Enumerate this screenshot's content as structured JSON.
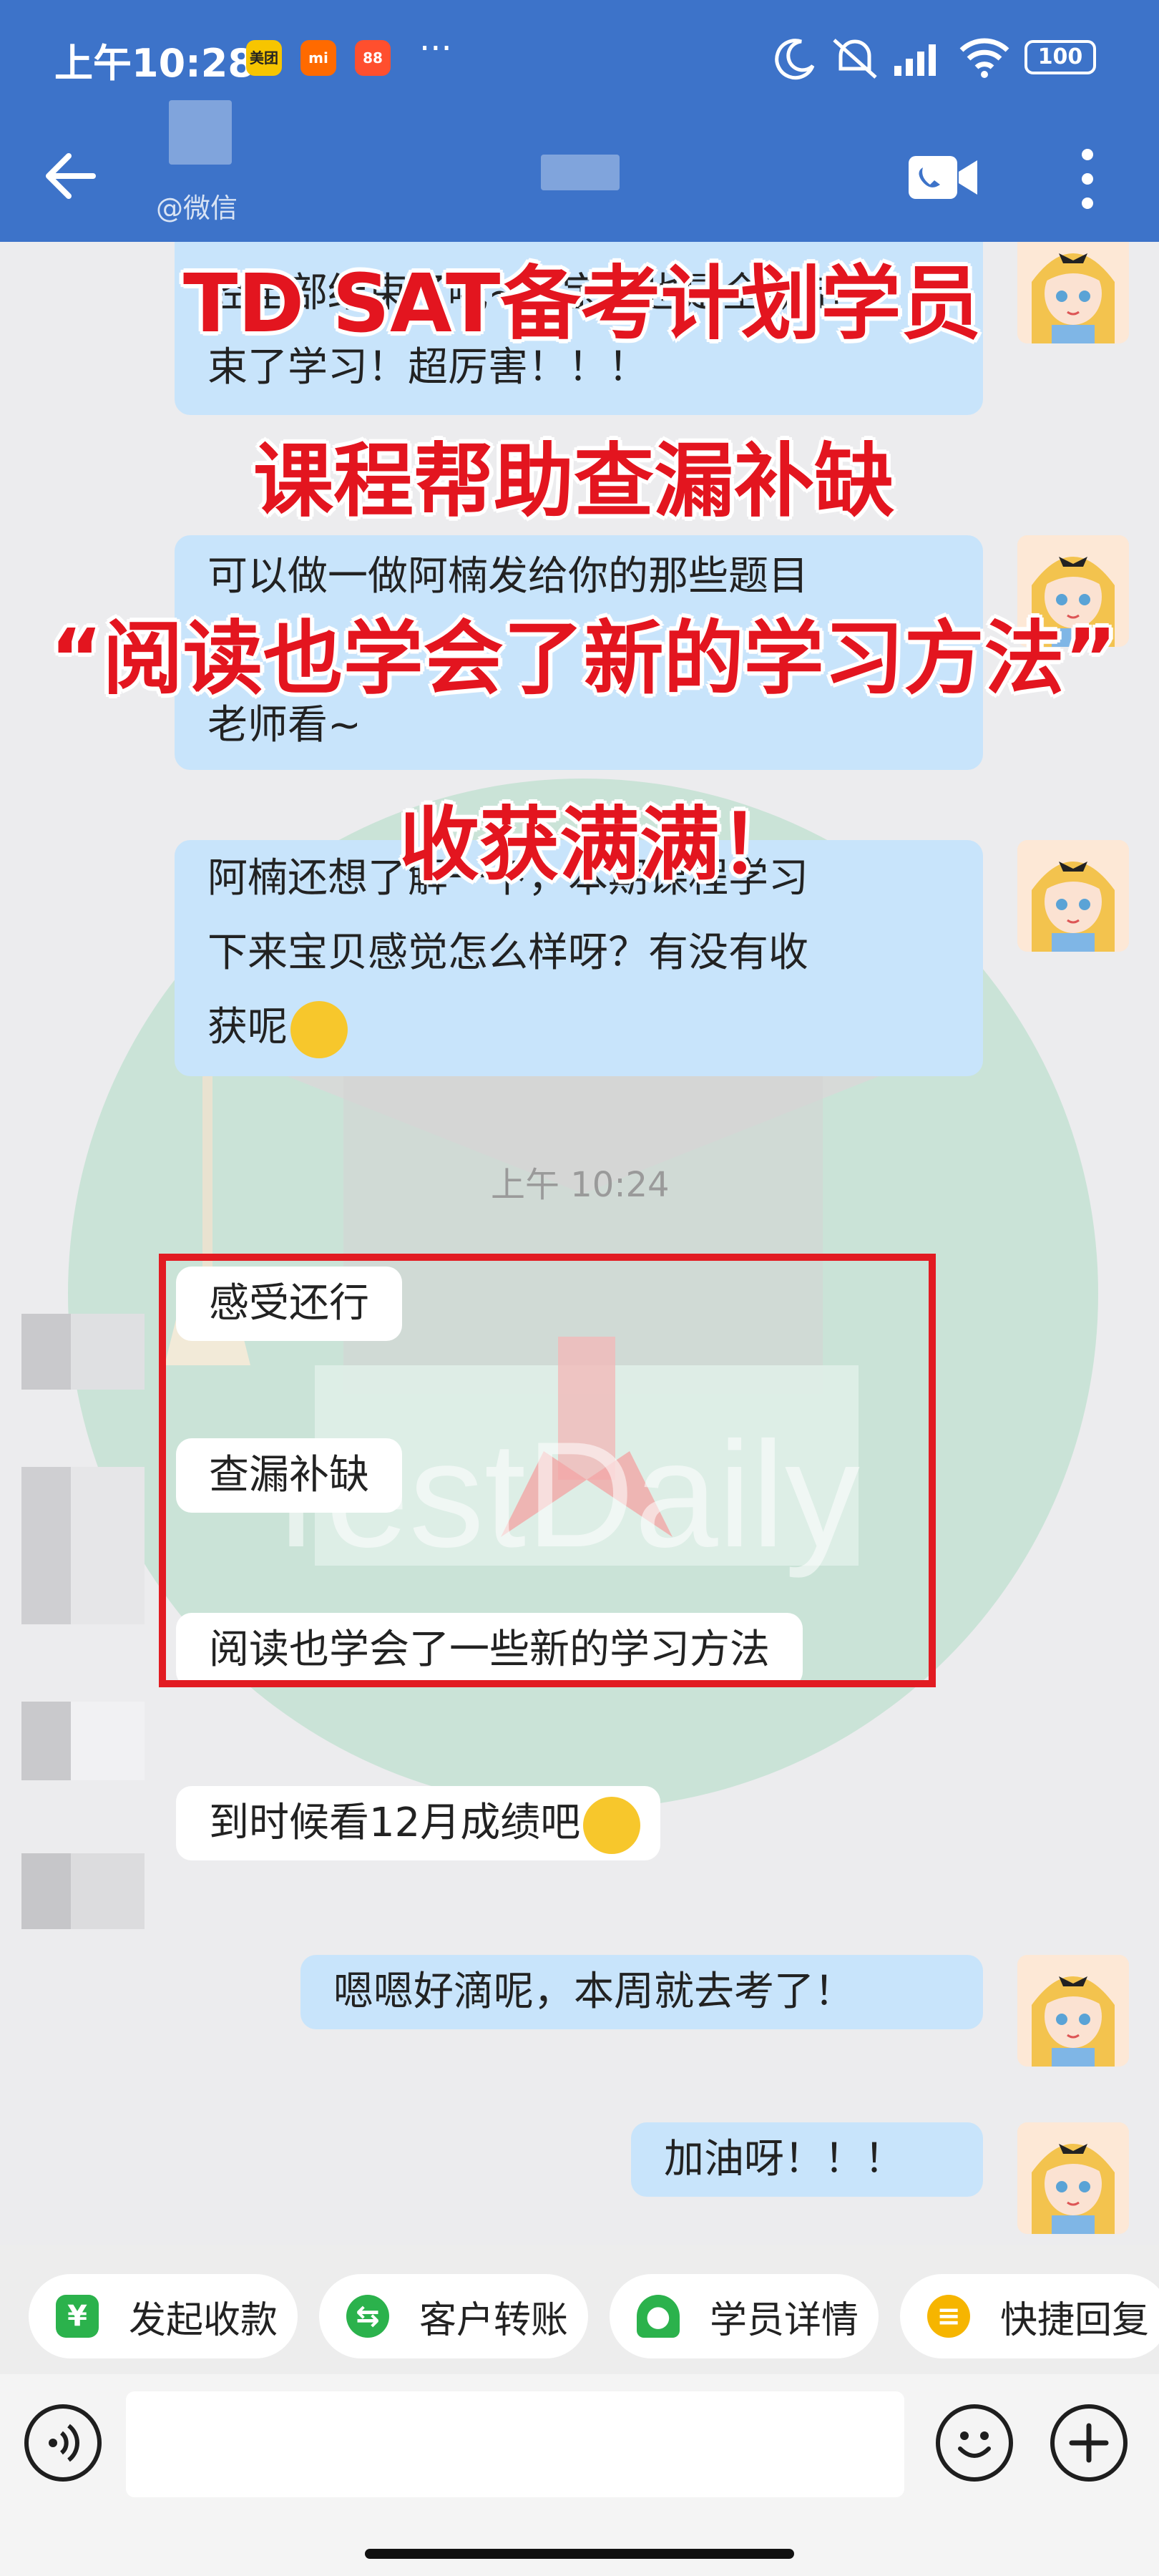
{
  "status_bar": {
    "time": "上午10:28",
    "app_icons": [
      "美团",
      "mi",
      "88"
    ],
    "more": "···",
    "battery": "100"
  },
  "header": {
    "back_icon": "arrow-left-icon",
    "contact_suffix": "@微信",
    "video_call_icon": "video-camera-icon",
    "menu_icon": "more-vertical-icon"
  },
  "overlay": {
    "line1": "TD SAT备考计划学员",
    "line2": "课程帮助查漏补缺",
    "line3": "“阅读也学会了新的学习方法”",
    "line4": "收获满满！"
  },
  "watermark": "TestDaily",
  "messages": {
    "m1": {
      "line1": "经全部结束了哦~小宝你也是全勤结",
      "line2": "束了学习！超厉害！！！"
    },
    "m2": {
      "line1": "可以做一做阿楠发给你的那些题目",
      "line2": "老师看~"
    },
    "m3": {
      "line1": "阿楠还想了解一下，本期课程学习",
      "line2": "下来宝贝感觉怎么样呀？有没有收",
      "line3": "获呢"
    },
    "timestamp": "上午 10:24",
    "r1": "感受还行",
    "r2": "查漏补缺",
    "r3": "阅读也学会了一些新的学习方法",
    "r4": "到时候看12月成绩吧",
    "m4": "嗯嗯好滴呢，本周就去考了！",
    "m5": "加油呀！！！"
  },
  "quick_actions": [
    {
      "label": "发起收款",
      "color": "#2bb24c"
    },
    {
      "label": "客户转账",
      "color": "#2bb24c"
    },
    {
      "label": "学员详情",
      "color": "#2bb24c"
    },
    {
      "label": "快捷回复",
      "color": "#f6b500"
    }
  ],
  "input": {
    "placeholder": ""
  }
}
